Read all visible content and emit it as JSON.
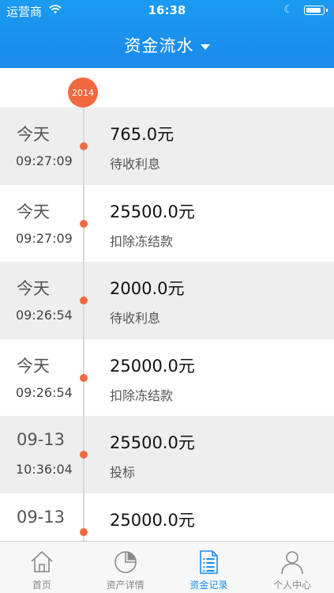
{
  "status_bar": {
    "carrier": "运营商",
    "time": "16:38"
  },
  "nav": {
    "title": "资金流水"
  },
  "timeline": {
    "year": "2014",
    "records": [
      {
        "day": "今天",
        "time": "09:27:09",
        "amount": "765.0元",
        "type": "待收利息"
      },
      {
        "day": "今天",
        "time": "09:27:09",
        "amount": "25500.0元",
        "type": "扣除冻结款"
      },
      {
        "day": "今天",
        "time": "09:26:54",
        "amount": "2000.0元",
        "type": "待收利息"
      },
      {
        "day": "今天",
        "time": "09:26:54",
        "amount": "25000.0元",
        "type": "扣除冻结款"
      },
      {
        "day": "09-13",
        "time": "10:36:04",
        "amount": "25500.0元",
        "type": "投标"
      },
      {
        "day": "09-13",
        "time": "",
        "amount": "25000.0元",
        "type": ""
      }
    ]
  },
  "tabbar": {
    "tabs": [
      {
        "label": "首页",
        "icon": "home-icon"
      },
      {
        "label": "资产详情",
        "icon": "pie-chart-icon"
      },
      {
        "label": "资金记录",
        "icon": "document-list-icon"
      },
      {
        "label": "个人中心",
        "icon": "person-icon"
      }
    ],
    "active_index": 2
  },
  "colors": {
    "nav_blue": "#1b89ec",
    "accent_orange": "#f2683f",
    "active_tab": "#1a8ef0"
  }
}
